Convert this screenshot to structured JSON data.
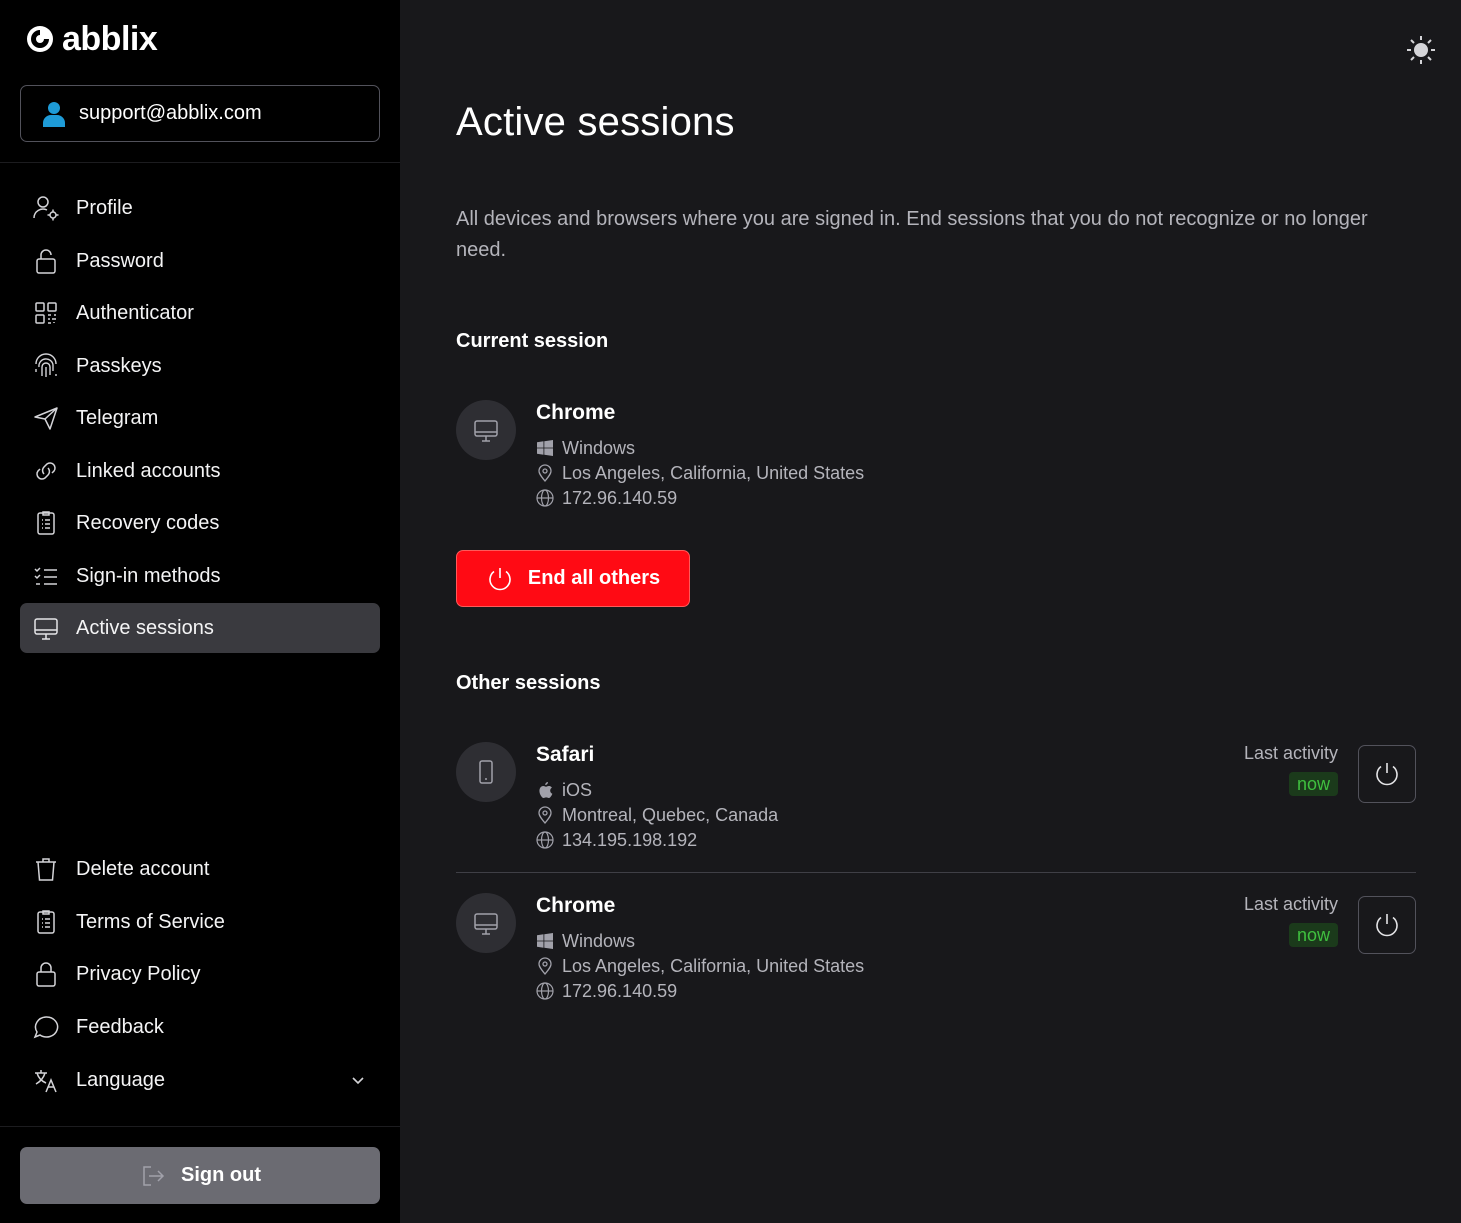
{
  "app": {
    "logo_text": "abblix"
  },
  "account": {
    "email": "support@abblix.com"
  },
  "nav": {
    "items": [
      {
        "label": "Profile",
        "icon": "user-gear-icon"
      },
      {
        "label": "Password",
        "icon": "lock-icon"
      },
      {
        "label": "Authenticator",
        "icon": "qr-code-icon"
      },
      {
        "label": "Passkeys",
        "icon": "fingerprint-icon"
      },
      {
        "label": "Telegram",
        "icon": "paper-plane-icon"
      },
      {
        "label": "Linked accounts",
        "icon": "link-icon"
      },
      {
        "label": "Recovery codes",
        "icon": "clipboard-list-icon"
      },
      {
        "label": "Sign-in methods",
        "icon": "checklist-icon"
      },
      {
        "label": "Active sessions",
        "icon": "monitor-icon",
        "active": true
      }
    ],
    "bottom_items": [
      {
        "label": "Delete account",
        "icon": "trash-icon"
      },
      {
        "label": "Terms of Service",
        "icon": "clipboard-list-icon"
      },
      {
        "label": "Privacy Policy",
        "icon": "lock-icon"
      },
      {
        "label": "Feedback",
        "icon": "chat-bubble-icon"
      },
      {
        "label": "Language",
        "icon": "translate-icon"
      }
    ],
    "sign_out_label": "Sign out"
  },
  "page": {
    "title": "Active sessions",
    "description": "All devices and browsers where you are signed in. End sessions that you do not recognize or no longer need.",
    "current_section_title": "Current session",
    "other_section_title": "Other sessions",
    "end_all_label": "End all others"
  },
  "current_session": {
    "browser": "Chrome",
    "os": "Windows",
    "location": "Los Angeles, California, United States",
    "ip": "172.96.140.59",
    "device_icon": "monitor-icon",
    "os_icon": "windows-icon"
  },
  "other_sessions": [
    {
      "browser": "Safari",
      "os": "iOS",
      "location": "Montreal, Quebec, Canada",
      "ip": "134.195.198.192",
      "last_activity_label": "Last activity",
      "last_activity": "now",
      "device_icon": "phone-icon",
      "os_icon": "apple-icon"
    },
    {
      "browser": "Chrome",
      "os": "Windows",
      "location": "Los Angeles, California, United States",
      "ip": "172.96.140.59",
      "last_activity_label": "Last activity",
      "last_activity": "now",
      "device_icon": "monitor-icon",
      "os_icon": "windows-icon"
    }
  ],
  "colors": {
    "sidebar_bg": "#000000",
    "main_bg": "#18181b",
    "danger": "#ff0a14",
    "active_nav_bg": "#3a3a3f",
    "now_badge_text": "#3fbf3f",
    "account_icon": "#1e9bd7"
  }
}
